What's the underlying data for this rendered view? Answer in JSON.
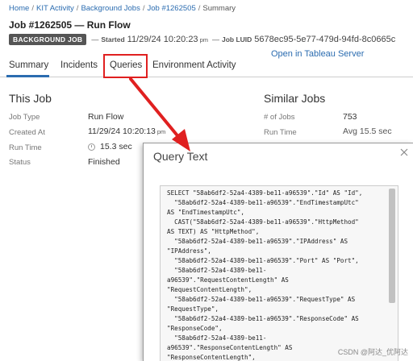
{
  "breadcrumb": {
    "items": [
      "Home",
      "KIT Activity",
      "Background Jobs",
      "Job #1262505"
    ],
    "current": "Summary",
    "separator": "/"
  },
  "job": {
    "title": "Job #1262505 — Run Flow",
    "badge": "BACKGROUND JOB",
    "dash": "—",
    "started_label": "Started",
    "started_value": "11/29/24 10:20:23",
    "started_suffix": "pm",
    "luid_label": "Job LUID",
    "luid_value": "5678ec95-5e77-479d-94fd-8c0665c",
    "open_link": "Open in Tableau Server"
  },
  "tabs": [
    "Summary",
    "Incidents",
    "Queries",
    "Environment Activity"
  ],
  "this_job": {
    "title": "This Job",
    "rows": [
      {
        "label": "Job Type",
        "value": "Run Flow"
      },
      {
        "label": "Created At",
        "value": "11/29/24 10:20:13",
        "suffix": "pm"
      },
      {
        "label": "Run Time",
        "value": "15.3 sec"
      },
      {
        "label": "Status",
        "value": "Finished"
      }
    ]
  },
  "similar_jobs": {
    "title": "Similar Jobs",
    "rows": [
      {
        "label": "# of Jobs",
        "value": "753"
      },
      {
        "label": "Run Time",
        "prefix": "Avg",
        "value": "15.5 sec"
      }
    ]
  },
  "query_panel": {
    "title": "Query Text",
    "text": "SELECT \"58ab6df2-52a4-4389-be11-a96539\".\"Id\" AS \"Id\",\n  \"58ab6df2-52a4-4389-be11-a96539\".\"EndTimestampUtc\"\nAS \"EndTimestampUtc\",\n  CAST(\"58ab6df2-52a4-4389-be11-a96539\".\"HttpMethod\"\nAS TEXT) AS \"HttpMethod\",\n  \"58ab6df2-52a4-4389-be11-a96539\".\"IPAddress\" AS\n\"IPAddress\",\n  \"58ab6df2-52a4-4389-be11-a96539\".\"Port\" AS \"Port\",\n  \"58ab6df2-52a4-4389-be11-\na96539\".\"RequestContentLength\" AS\n\"RequestContentLength\",\n  \"58ab6df2-52a4-4389-be11-a96539\".\"RequestType\" AS\n\"RequestType\",\n  \"58ab6df2-52a4-4389-be11-a96539\".\"ResponseCode\" AS\n\"ResponseCode\",\n  \"58ab6df2-52a4-4389-be11-\na96539\".\"ResponseContentLength\" AS\n\"ResponseContentLength\","
  },
  "watermark": "CSDN @阿达_优阿达",
  "colors": {
    "accent": "#2b6cb0",
    "annotation": "#e02020",
    "badge": "#555555"
  },
  "icons": [
    "clock-icon",
    "close-icon",
    "annotation-arrow"
  ]
}
